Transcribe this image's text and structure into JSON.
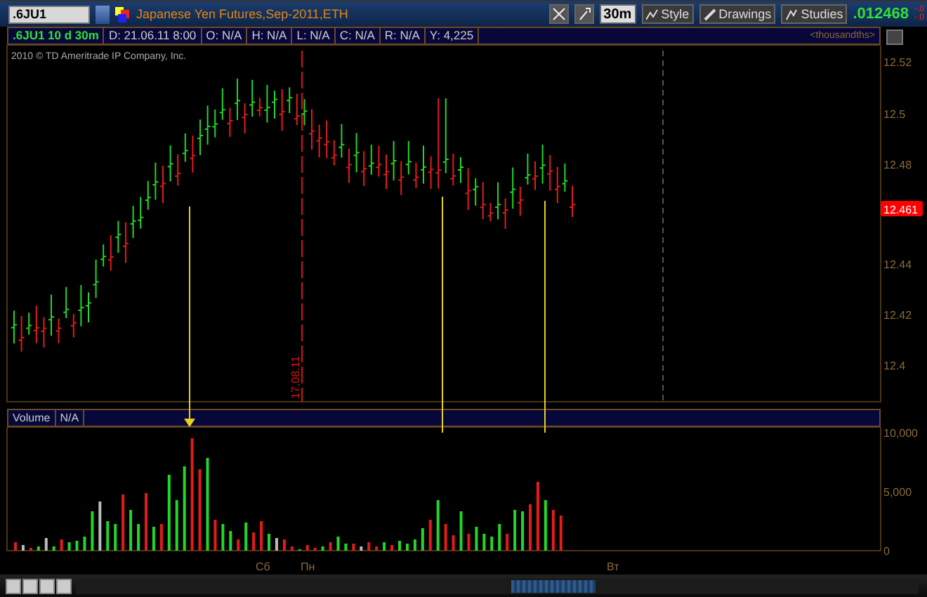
{
  "symbol_field": {
    "value": ".6JU1"
  },
  "title": "Japanese Yen Futures,Sep-2011,ETH",
  "toolbar": [
    {
      "kind": "interval",
      "label": "30m"
    },
    {
      "kind": "style",
      "label": "Style"
    },
    {
      "kind": "drawings",
      "label": "Drawings"
    },
    {
      "kind": "studies",
      "label": "Studies"
    }
  ],
  "last_price": ".012468",
  "net_change": [
    "-.0",
    "-.0"
  ],
  "info": [
    {
      "kind": "symbol",
      "text": ".6JU1 10 d 30m"
    },
    {
      "kind": "field",
      "text": "D: 21.06.11 8:00"
    },
    {
      "kind": "field",
      "text": "O: N/A"
    },
    {
      "kind": "field",
      "text": "H: N/A"
    },
    {
      "kind": "field",
      "text": "L: N/A"
    },
    {
      "kind": "field",
      "text": "C: N/A"
    },
    {
      "kind": "field",
      "text": "R: N/A"
    },
    {
      "kind": "field",
      "text": "Y: 4,225"
    }
  ],
  "price_format": "<thousandths>",
  "copyright": "2010 © TD Ameritrade IP Company, Inc.",
  "price_axis": [
    "12.52",
    "12.5",
    "12.48",
    "12.44",
    "12.42",
    "12.4"
  ],
  "current_price": "12.461",
  "marker_date": "17.08.11",
  "volume": {
    "label": "Volume",
    "value": "N/A",
    "axis": [
      "10,000",
      "5,000",
      "0"
    ]
  },
  "day_labels": [
    "Сб",
    "Пн",
    "Вт"
  ]
}
